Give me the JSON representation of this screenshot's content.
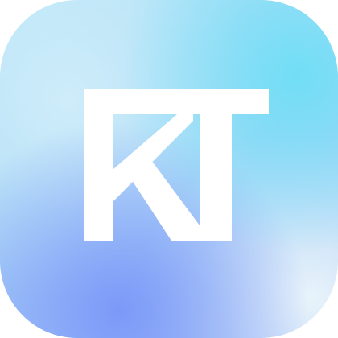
{
  "app_icon": {
    "name": "KT",
    "logo_lettering": "KT",
    "colors": {
      "gradient_cyan": "#6edef6",
      "gradient_blue": "#7a96f8",
      "gradient_light": "#d2eefa",
      "glyph": "#ffffff"
    }
  }
}
